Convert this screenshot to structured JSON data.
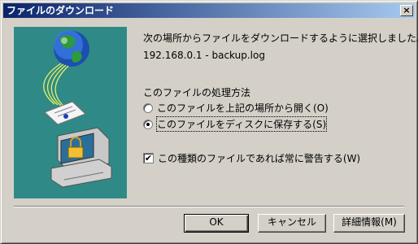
{
  "window": {
    "title": "ファイルのダウンロード",
    "close_label": "×"
  },
  "illustration": {
    "icons": [
      "globe-icon",
      "document-icon",
      "computer-icon",
      "lock-icon"
    ]
  },
  "message": "次の場所からファイルをダウンロードするように選択しました。",
  "file_source": "192.168.0.1 - backup.log",
  "section_title": "このファイルの処理方法",
  "options": [
    {
      "label": "このファイルを上記の場所から開く(O)",
      "selected": false
    },
    {
      "label": "このファイルをディスクに保存する(S)",
      "selected": true
    }
  ],
  "always_ask": {
    "label": "この種類のファイルであれば常に警告する(W)",
    "checked": true,
    "mark": "✔"
  },
  "buttons": {
    "ok": "OK",
    "cancel": "キャンセル",
    "details": "詳細情報(M)"
  },
  "colors": {
    "title_start": "#0a246a",
    "title_end": "#a6caf0",
    "illustration_bg": "#2f8a87",
    "dialog_bg": "#d4d0c8"
  }
}
